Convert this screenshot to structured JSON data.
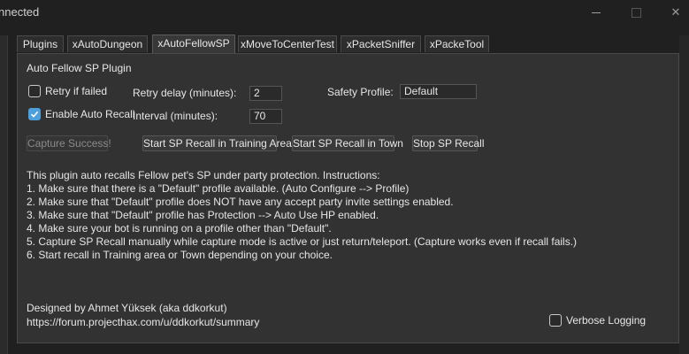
{
  "window": {
    "title": "nnected",
    "minimize_icon": "minimize-icon",
    "maximize_icon": "maximize-icon",
    "close_glyph": "✕"
  },
  "tabs": [
    {
      "label": "Plugins"
    },
    {
      "label": "xAutoDungeon"
    },
    {
      "label": "xAutoFellowSP"
    },
    {
      "label": "xMoveToCenterTest"
    },
    {
      "label": "xPacketSniffer"
    },
    {
      "label": "xPackeTool"
    }
  ],
  "panel": {
    "group_title": "Auto Fellow SP Plugin",
    "retry_if_failed": {
      "label": "Retry if failed",
      "checked": false
    },
    "enable_auto_recall": {
      "label": "Enable Auto Recall",
      "checked": true
    },
    "retry_delay": {
      "label": "Retry delay (minutes):",
      "value": "2"
    },
    "interval": {
      "label": "Interval (minutes):",
      "value": "70"
    },
    "safety_profile": {
      "label": "Safety Profile:",
      "value": "Default"
    },
    "buttons": {
      "capture": "Capture Success!",
      "training": "Start SP Recall in Training Area",
      "town": "Start SP Recall in Town",
      "stop": "Stop SP Recall"
    },
    "instructions": [
      "This plugin auto recalls Fellow pet's SP under party protection. Instructions:",
      "1. Make sure that there is a \"Default\" profile available. (Auto Configure --> Profile)",
      "2. Make sure that \"Default\" profile does NOT have any accept party invite settings enabled.",
      "3. Make sure that \"Default\" profile has Protection --> Auto Use HP enabled.",
      "4. Make sure your bot is running on a profile other than \"Default\".",
      "5. Capture SP Recall manually while capture mode is active or just return/teleport. (Capture works even if recall fails.)",
      "6. Start recall in Training area or Town depending on your choice."
    ],
    "credit": {
      "designed_by": "Designed by Ahmet Yüksek (aka ddkorkut)",
      "url": "https://forum.projecthax.com/u/ddkorkut/summary"
    },
    "verbose_logging": {
      "label": "Verbose Logging",
      "checked": false
    }
  },
  "colors": {
    "accent": "#4ea0dc",
    "background": "#202020",
    "panel": "#323232"
  }
}
